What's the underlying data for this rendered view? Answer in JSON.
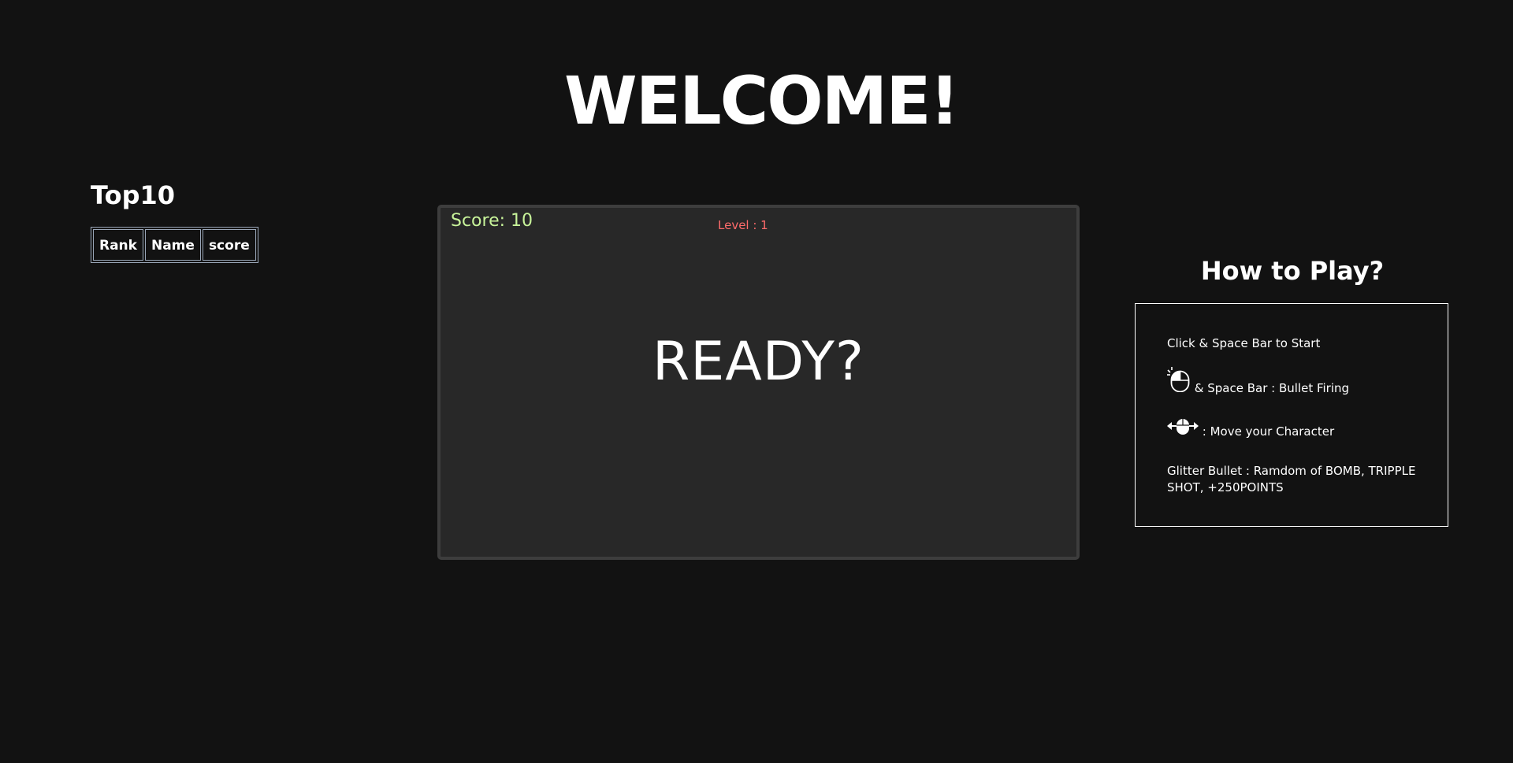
{
  "header": {
    "title": "WELCOME!"
  },
  "leaderboard": {
    "title": "Top10",
    "columns": [
      "Rank",
      "Name",
      "score"
    ]
  },
  "game": {
    "score_text": "Score: 10",
    "level_text": "Level : 1",
    "ready_text": "READY?"
  },
  "howto": {
    "title": "How to Play?",
    "start_text": "Click & Space Bar to Start",
    "fire_text": "& Space Bar : Bullet Firing",
    "move_text": ": Move your Character",
    "glitter_text": "Glitter Bullet : Ramdom of BOMB, TRIPPLE SHOT, +250POINTS",
    "fire_icon": "mouse-click-icon",
    "move_icon": "mouse-move-arrows-icon"
  },
  "colors": {
    "background": "#121212",
    "game_background": "#282828",
    "score": "#c8f49a",
    "level": "#ff6b6b"
  }
}
